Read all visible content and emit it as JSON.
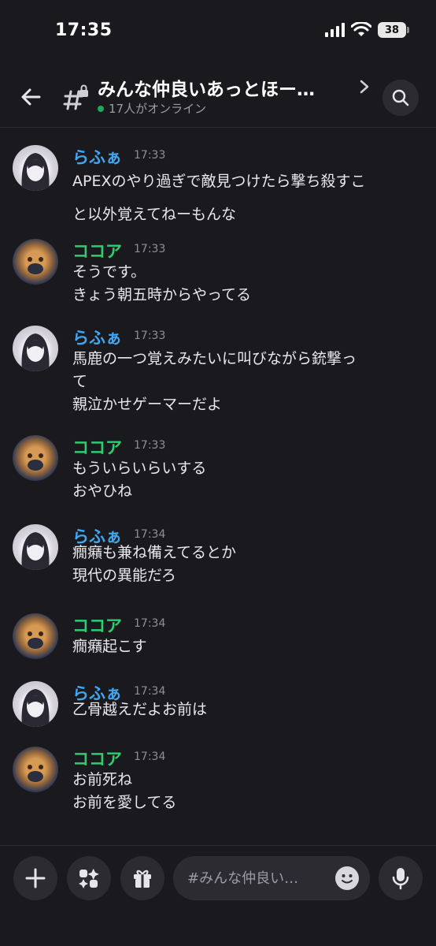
{
  "status": {
    "time": "17:35",
    "battery": "38"
  },
  "header": {
    "title": "みんな仲良いあっとほー…",
    "online": "17人がオンライン"
  },
  "messages": [
    {
      "author": "らふぁ",
      "kind": "rafa",
      "time": "17:33",
      "text": "APEXのやり過ぎで敵見つけたら撃ち殺すこ\nと以外覚えてねーもんな"
    },
    {
      "author": "ココア",
      "kind": "cocoa",
      "time": "17:33",
      "text": "そうです。\nきょう朝五時からやってる"
    },
    {
      "author": "らふぁ",
      "kind": "rafa",
      "time": "17:33",
      "text": "馬鹿の一つ覚えみたいに叫びながら銃撃っ\nて\n親泣かせゲーマーだよ"
    },
    {
      "author": "ココア",
      "kind": "cocoa",
      "time": "17:33",
      "text": "もういらいらいする\nおやひね"
    },
    {
      "author": "らふぁ",
      "kind": "rafa",
      "time": "17:34",
      "text": "癇癪も兼ね備えてるとか\n現代の異能だろ"
    },
    {
      "author": "ココア",
      "kind": "cocoa",
      "time": "17:34",
      "text": "癇癪起こす"
    },
    {
      "author": "らふぁ",
      "kind": "rafa",
      "time": "17:34",
      "text": "乙骨越えだよお前は"
    },
    {
      "author": "ココア",
      "kind": "cocoa",
      "time": "17:34",
      "text": "お前死ね\nお前を愛してる"
    }
  ],
  "composer": {
    "placeholder": "#みんな仲良い…"
  },
  "colors": {
    "rafa_name": "#3fa6f0",
    "cocoa_name": "#2ecc71",
    "online_dot": "#23a55a",
    "background": "#1a1a1e"
  },
  "icons": [
    "back-arrow-icon",
    "channel-hash-lock-icon",
    "chevron-right-icon",
    "search-icon",
    "plus-icon",
    "apps-icon",
    "gift-icon",
    "emoji-icon",
    "microphone-icon"
  ]
}
